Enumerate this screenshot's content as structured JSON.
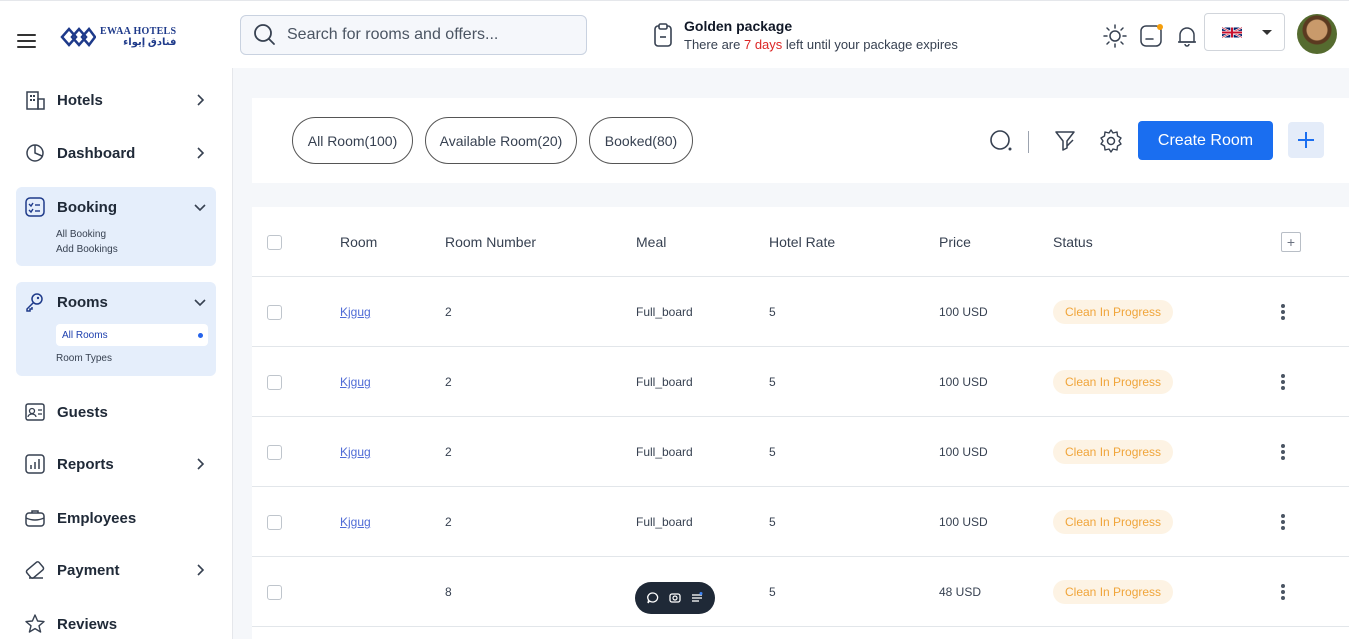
{
  "header": {
    "logo_en": "EWAA HOTELS",
    "logo_ar": "فنادق إيواء",
    "search_placeholder": "Search for rooms and offers...",
    "package_title": "Golden package",
    "package_prefix": "There are ",
    "package_days": "7 days",
    "package_suffix": " left until your package expires",
    "icons": [
      "sun-icon",
      "chat-icon",
      "bell-icon"
    ],
    "language_flag": "uk-flag"
  },
  "sidebar": {
    "items": [
      {
        "label": "Hotels",
        "icon": "hotel-icon"
      },
      {
        "label": "Dashboard",
        "icon": "pie-chart-icon"
      },
      {
        "label": "Booking",
        "icon": "checklist-icon",
        "subs": [
          "All Booking",
          "Add Bookings"
        ]
      },
      {
        "label": "Rooms",
        "icon": "key-icon",
        "subs": [
          "All Rooms",
          "Room Types"
        ]
      },
      {
        "label": "Guests",
        "icon": "id-card-icon"
      },
      {
        "label": "Reports",
        "icon": "report-icon"
      },
      {
        "label": "Employees",
        "icon": "briefcase-icon"
      },
      {
        "label": "Payment",
        "icon": "card-icon"
      },
      {
        "label": "Reviews",
        "icon": "star-icon"
      }
    ]
  },
  "filters": {
    "pills": [
      "All Room(100)",
      "Available Room(20)",
      "Booked(80)"
    ],
    "create_label": "Create Room"
  },
  "table": {
    "columns": [
      "Room",
      "Room Number",
      "Meal",
      "Hotel Rate",
      "Price",
      "Status"
    ],
    "rows": [
      {
        "room": "Kjgug",
        "number": "2",
        "meal": "Full_board",
        "rate": "5",
        "price": "100 USD",
        "status": "Clean In Progress"
      },
      {
        "room": "Kjgug",
        "number": "2",
        "meal": "Full_board",
        "rate": "5",
        "price": "100 USD",
        "status": "Clean In Progress"
      },
      {
        "room": "Kjgug",
        "number": "2",
        "meal": "Full_board",
        "rate": "5",
        "price": "100 USD",
        "status": "Clean In Progress"
      },
      {
        "room": "Kjgug",
        "number": "2",
        "meal": "Full_board",
        "rate": "5",
        "price": "100 USD",
        "status": "Clean In Progress"
      },
      {
        "room": "",
        "number": "8",
        "meal": "",
        "rate": "5",
        "price": "48 USD",
        "status": "Clean In Progress"
      }
    ]
  },
  "colors": {
    "accent": "#1a6ef0",
    "status_text": "#f0a53a",
    "status_bg": "#fdf3e4",
    "warning": "#dc2626"
  }
}
